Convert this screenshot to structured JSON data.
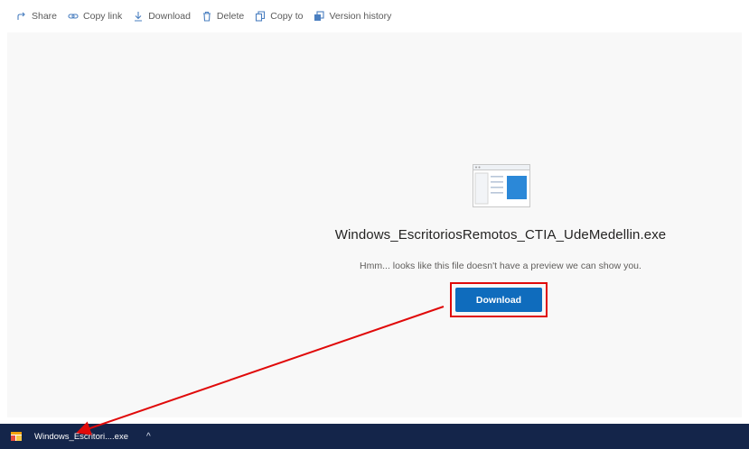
{
  "toolbar": {
    "items": [
      {
        "label": "Share",
        "icon": "share-icon"
      },
      {
        "label": "Copy link",
        "icon": "link-icon"
      },
      {
        "label": "Download",
        "icon": "download-icon"
      },
      {
        "label": "Delete",
        "icon": "trash-icon"
      },
      {
        "label": "Copy to",
        "icon": "copy-icon"
      },
      {
        "label": "Version history",
        "icon": "version-history-icon"
      }
    ]
  },
  "preview": {
    "icon": "exe-file-icon",
    "file_name": "Windows_EscritoriosRemotos_CTIA_UdeMedellin.exe",
    "message": "Hmm... looks like this file doesn't have a preview we can show you.",
    "download_label": "Download"
  },
  "taskbar": {
    "download_item_label": "Windows_Escritori....exe",
    "download_item_icon": "exe-file-icon",
    "chevron_label": "^"
  },
  "colors": {
    "accent": "#0f6cbd",
    "annotation": "#e00a0a",
    "taskbar": "#14254a",
    "content_bg": "#f8f8f8"
  }
}
